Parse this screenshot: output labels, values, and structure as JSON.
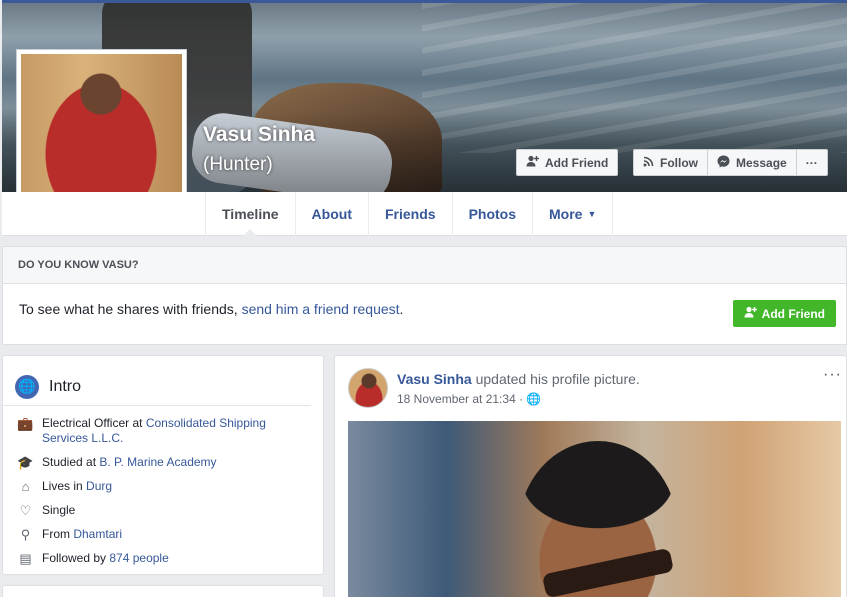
{
  "profile": {
    "name": "Vasu Sinha",
    "nickname": "(Hunter)"
  },
  "header_actions": {
    "add_friend": "Add Friend",
    "follow": "Follow",
    "message": "Message",
    "more": "···"
  },
  "tabs": [
    {
      "label": "Timeline"
    },
    {
      "label": "About"
    },
    {
      "label": "Friends"
    },
    {
      "label": "Photos"
    },
    {
      "label": "More"
    }
  ],
  "know": {
    "heading": "DO YOU KNOW VASU?",
    "text": "To see what he shares with friends, ",
    "link": "send him a friend request",
    "period": ".",
    "button": "Add Friend"
  },
  "intro": {
    "title": "Intro",
    "work_prefix": "Electrical Officer at ",
    "work_link": "Consolidated Shipping Services L.L.C.",
    "study_prefix": "Studied at ",
    "study_link": "B. P. Marine Academy",
    "lives_prefix": "Lives in ",
    "lives_link": "Durg",
    "relationship": "Single",
    "from_prefix": "From ",
    "from_link": "Dhamtari",
    "followed_prefix": "Followed by ",
    "followed_link": "874 people"
  },
  "post": {
    "author": "Vasu Sinha",
    "action": " updated his profile picture.",
    "time": "18 November at 21:34 · ",
    "more": "···"
  },
  "colors": {
    "link": "#365899",
    "brand": "#3b5998",
    "green": "#42b72a",
    "background": "#e9ebee"
  },
  "icons": {
    "add_friend": "person-plus-icon",
    "follow": "rss-icon",
    "message": "messenger-icon",
    "intro": "globe-icon",
    "work": "briefcase-icon",
    "study": "graduation-cap-icon",
    "lives": "house-icon",
    "relationship": "heart-icon",
    "from": "map-pin-icon",
    "followers": "feed-icon",
    "privacy": "globe-small-icon"
  }
}
